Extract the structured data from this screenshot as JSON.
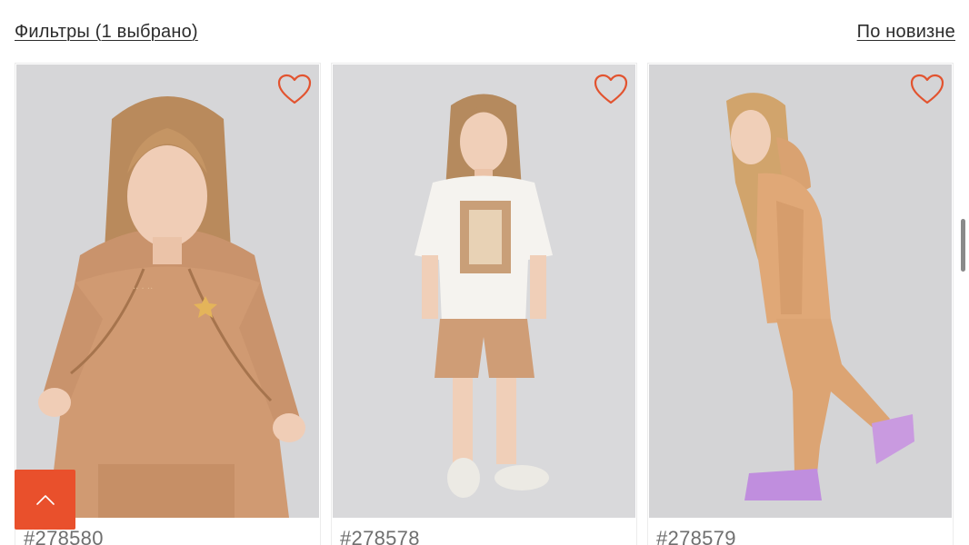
{
  "toolbar": {
    "filters_label": "Фильтры (1 выбрано)",
    "sort_label": "По новизне"
  },
  "products": [
    {
      "sku": "#278580",
      "favorite_icon": "heart-outline-icon"
    },
    {
      "sku": "#278578",
      "favorite_icon": "heart-outline-icon"
    },
    {
      "sku": "#278579",
      "favorite_icon": "heart-outline-icon"
    }
  ],
  "colors": {
    "accent": "#e9502c",
    "heart": "#e2532f",
    "garment_main": "#d39c74",
    "sneakers": "#c99ae0"
  },
  "scroll_top_icon": "chevron-up-icon"
}
